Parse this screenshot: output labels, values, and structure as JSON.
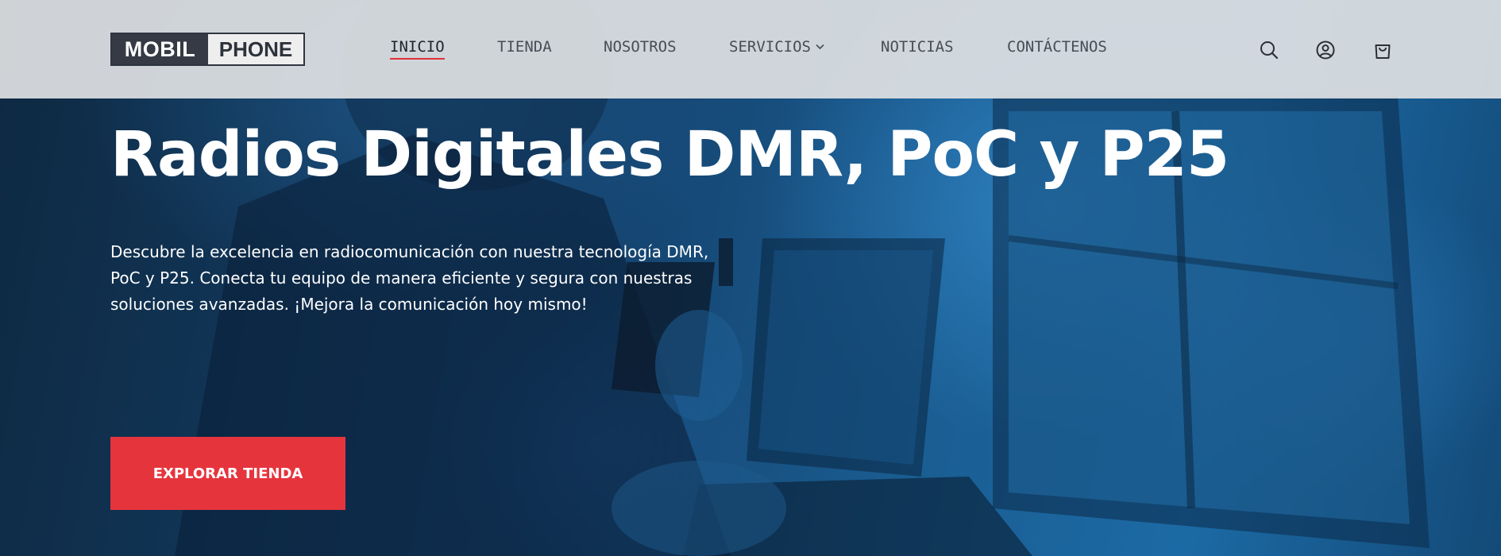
{
  "brand": {
    "logo_left": "MOBIL",
    "logo_right": "PHONE"
  },
  "nav": {
    "items": [
      {
        "label": "INICIO",
        "active": true
      },
      {
        "label": "TIENDA",
        "active": false
      },
      {
        "label": "NOSOTROS",
        "active": false
      },
      {
        "label": "SERVICIOS",
        "active": false,
        "has_dropdown": true
      },
      {
        "label": "NOTICIAS",
        "active": false
      },
      {
        "label": "CONTÁCTENOS",
        "active": false
      }
    ]
  },
  "header_icons": [
    "search-icon",
    "account-icon",
    "cart-icon"
  ],
  "hero": {
    "title": "Radios Digitales DMR, PoC y P25",
    "description": "Descubre la excelencia en radiocomunicación con nuestra tecnología DMR, PoC y P25. Conecta tu equipo de manera eficiente y segura con nuestras soluciones avanzadas. ¡Mejora la comunicación hoy mismo!",
    "cta_label": "EXPLORAR TIENDA"
  },
  "colors": {
    "accent": "#e6343d",
    "header_bg": "#dee0e2",
    "logo_dark": "#353a44",
    "hero_tint": "#1c6aa5",
    "text_light": "#ffffff"
  }
}
